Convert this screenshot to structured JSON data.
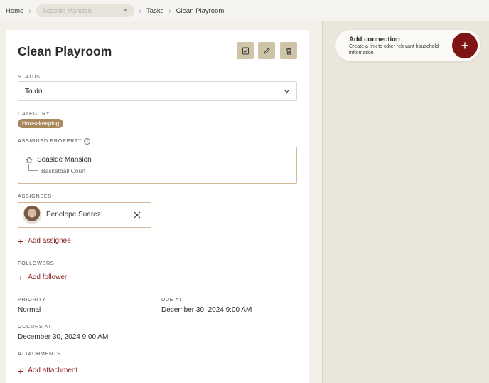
{
  "breadcrumb": {
    "home": "Home",
    "property_select": "Seaside Mansion",
    "tasks": "Tasks",
    "current": "Clean Playroom"
  },
  "task": {
    "title": "Clean Playroom",
    "status_label": "STATUS",
    "status_value": "To do",
    "category_label": "CATEGORY",
    "category_value": "Housekeeping",
    "assigned_property_label": "ASSIGNED PROPERTY",
    "property_name": "Seaside Mansion",
    "property_sub": "Basketball Court",
    "assignees_label": "ASSIGNEES",
    "assignee_name": "Penelope Suarez",
    "add_assignee": "Add assignee",
    "followers_label": "FOLLOWERS",
    "add_follower": "Add follower",
    "priority_label": "PRIORITY",
    "priority_value": "Normal",
    "due_label": "DUE AT",
    "due_value": "December 30, 2024 9:00 AM",
    "occurs_label": "OCCURS AT",
    "occurs_value": "December 30, 2024 9:00 AM",
    "attachments_label": "ATTACHMENTS",
    "add_attachment": "Add attachment"
  },
  "connection": {
    "title": "Add connection",
    "description": "Create a link to other relevant household information"
  },
  "colors": {
    "accent": "#8b1a1a",
    "button_bg": "#cfc3a8",
    "badge_bg": "#a9885e"
  }
}
